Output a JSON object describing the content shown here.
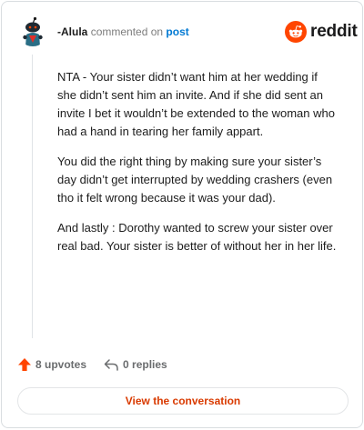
{
  "header": {
    "author": "-Alula",
    "commented_text": "commented on",
    "post_link": "post"
  },
  "brand": {
    "logo_icon": "reddit-alien-icon",
    "wordmark": "reddit",
    "color": "#ff4500"
  },
  "comment": {
    "paragraphs": [
      "NTA - Your sister didn’t want him at her wedding if she didn’t sent him an invite. And if she did sent an invite I bet it wouldn’t be extended to the woman who had a hand in tearing her family appart.",
      "You did the right thing by making sure your sister’s day didn’t get interrupted by wedding crashers (even tho it felt wrong because it was your dad).",
      "And lastly : Dorothy wanted to screw your sister over real bad. Your sister is better of without her in her life."
    ]
  },
  "actions": {
    "upvotes_label": "8 upvotes",
    "upvote_icon": "upvote-arrow-icon",
    "upvote_color": "#ff4500",
    "replies_label": "0 replies",
    "reply_icon": "reply-arrow-icon"
  },
  "footer": {
    "view_button_label": "View the conversation",
    "accent_color": "#d93a00"
  }
}
